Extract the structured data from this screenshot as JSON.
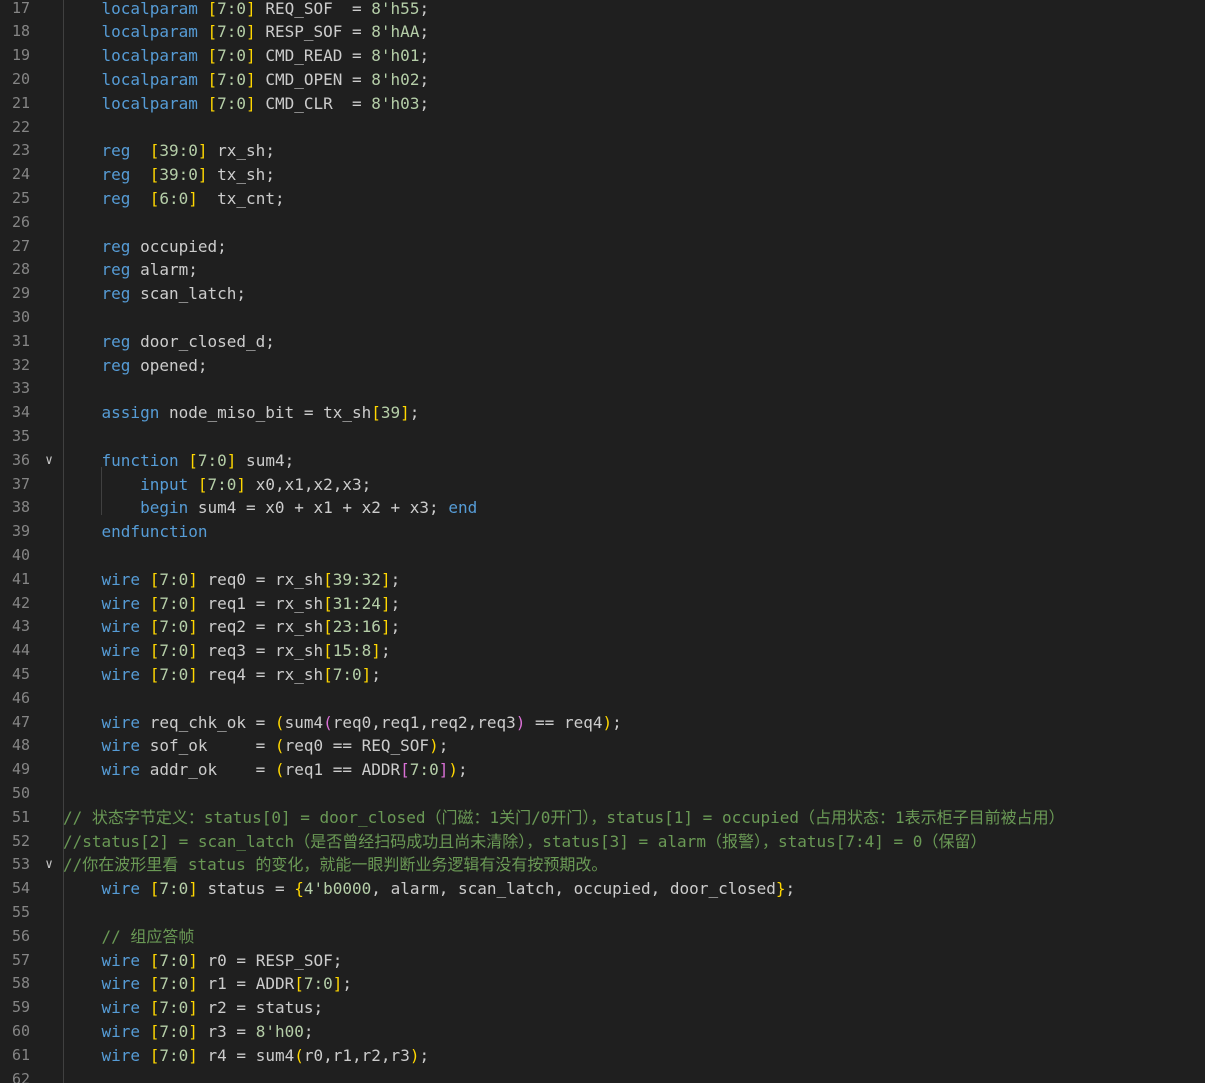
{
  "editor": {
    "language": "verilog",
    "first_line_number": 17,
    "folded_lines": [
      36,
      53
    ],
    "lines": [
      {
        "n": "17",
        "tokens": [
          [
            "    ",
            ""
          ],
          [
            "localparam",
            "kw"
          ],
          [
            " ",
            ""
          ],
          [
            "[",
            "b1"
          ],
          [
            "7:0",
            "num"
          ],
          [
            "]",
            "b1"
          ],
          [
            " REQ_SOF  = ",
            "id"
          ],
          [
            "8'h55",
            "num"
          ],
          [
            ";",
            "id"
          ]
        ]
      },
      {
        "n": "18",
        "tokens": [
          [
            "    ",
            ""
          ],
          [
            "localparam",
            "kw"
          ],
          [
            " ",
            ""
          ],
          [
            "[",
            "b1"
          ],
          [
            "7:0",
            "num"
          ],
          [
            "]",
            "b1"
          ],
          [
            " RESP_SOF = ",
            "id"
          ],
          [
            "8'hAA",
            "num"
          ],
          [
            ";",
            "id"
          ]
        ]
      },
      {
        "n": "19",
        "tokens": [
          [
            "    ",
            ""
          ],
          [
            "localparam",
            "kw"
          ],
          [
            " ",
            ""
          ],
          [
            "[",
            "b1"
          ],
          [
            "7:0",
            "num"
          ],
          [
            "]",
            "b1"
          ],
          [
            " CMD_READ = ",
            "id"
          ],
          [
            "8'h01",
            "num"
          ],
          [
            ";",
            "id"
          ]
        ]
      },
      {
        "n": "20",
        "tokens": [
          [
            "    ",
            ""
          ],
          [
            "localparam",
            "kw"
          ],
          [
            " ",
            ""
          ],
          [
            "[",
            "b1"
          ],
          [
            "7:0",
            "num"
          ],
          [
            "]",
            "b1"
          ],
          [
            " CMD_OPEN = ",
            "id"
          ],
          [
            "8'h02",
            "num"
          ],
          [
            ";",
            "id"
          ]
        ]
      },
      {
        "n": "21",
        "tokens": [
          [
            "    ",
            ""
          ],
          [
            "localparam",
            "kw"
          ],
          [
            " ",
            ""
          ],
          [
            "[",
            "b1"
          ],
          [
            "7:0",
            "num"
          ],
          [
            "]",
            "b1"
          ],
          [
            " CMD_CLR  = ",
            "id"
          ],
          [
            "8'h03",
            "num"
          ],
          [
            ";",
            "id"
          ]
        ]
      },
      {
        "n": "22",
        "tokens": []
      },
      {
        "n": "23",
        "tokens": [
          [
            "    ",
            ""
          ],
          [
            "reg",
            "kw"
          ],
          [
            "  ",
            ""
          ],
          [
            "[",
            "b1"
          ],
          [
            "39:0",
            "num"
          ],
          [
            "]",
            "b1"
          ],
          [
            " rx_sh;",
            "id"
          ]
        ]
      },
      {
        "n": "24",
        "tokens": [
          [
            "    ",
            ""
          ],
          [
            "reg",
            "kw"
          ],
          [
            "  ",
            ""
          ],
          [
            "[",
            "b1"
          ],
          [
            "39:0",
            "num"
          ],
          [
            "]",
            "b1"
          ],
          [
            " tx_sh;",
            "id"
          ]
        ]
      },
      {
        "n": "25",
        "tokens": [
          [
            "    ",
            ""
          ],
          [
            "reg",
            "kw"
          ],
          [
            "  ",
            ""
          ],
          [
            "[",
            "b1"
          ],
          [
            "6:0",
            "num"
          ],
          [
            "]",
            "b1"
          ],
          [
            "  tx_cnt;",
            "id"
          ]
        ]
      },
      {
        "n": "26",
        "tokens": []
      },
      {
        "n": "27",
        "tokens": [
          [
            "    ",
            ""
          ],
          [
            "reg",
            "kw"
          ],
          [
            " occupied;",
            "id"
          ]
        ]
      },
      {
        "n": "28",
        "tokens": [
          [
            "    ",
            ""
          ],
          [
            "reg",
            "kw"
          ],
          [
            " alarm;",
            "id"
          ]
        ]
      },
      {
        "n": "29",
        "tokens": [
          [
            "    ",
            ""
          ],
          [
            "reg",
            "kw"
          ],
          [
            " scan_latch;",
            "id"
          ]
        ]
      },
      {
        "n": "30",
        "tokens": []
      },
      {
        "n": "31",
        "tokens": [
          [
            "    ",
            ""
          ],
          [
            "reg",
            "kw"
          ],
          [
            " door_closed_d;",
            "id"
          ]
        ]
      },
      {
        "n": "32",
        "tokens": [
          [
            "    ",
            ""
          ],
          [
            "reg",
            "kw"
          ],
          [
            " opened;",
            "id"
          ]
        ]
      },
      {
        "n": "33",
        "tokens": []
      },
      {
        "n": "34",
        "tokens": [
          [
            "    ",
            ""
          ],
          [
            "assign",
            "kw"
          ],
          [
            " node_miso_bit = tx_sh",
            "id"
          ],
          [
            "[",
            "b1"
          ],
          [
            "39",
            "num"
          ],
          [
            "]",
            "b1"
          ],
          [
            ";",
            "id"
          ]
        ]
      },
      {
        "n": "35",
        "tokens": []
      },
      {
        "n": "36",
        "tokens": [
          [
            "    ",
            ""
          ],
          [
            "function",
            "kw"
          ],
          [
            " ",
            ""
          ],
          [
            "[",
            "b1"
          ],
          [
            "7:0",
            "num"
          ],
          [
            "]",
            "b1"
          ],
          [
            " sum4;",
            "id"
          ]
        ]
      },
      {
        "n": "37",
        "tokens": [
          [
            "        ",
            ""
          ],
          [
            "input",
            "kw"
          ],
          [
            " ",
            ""
          ],
          [
            "[",
            "b1"
          ],
          [
            "7:0",
            "num"
          ],
          [
            "]",
            "b1"
          ],
          [
            " x0,x1,x2,x3;",
            "id"
          ]
        ]
      },
      {
        "n": "38",
        "tokens": [
          [
            "        ",
            ""
          ],
          [
            "begin",
            "kw"
          ],
          [
            " sum4 = x0 + x1 + x2 + x3; ",
            "id"
          ],
          [
            "end",
            "kw"
          ]
        ]
      },
      {
        "n": "39",
        "tokens": [
          [
            "    ",
            ""
          ],
          [
            "endfunction",
            "kw"
          ]
        ]
      },
      {
        "n": "40",
        "tokens": []
      },
      {
        "n": "41",
        "tokens": [
          [
            "    ",
            ""
          ],
          [
            "wire",
            "kw"
          ],
          [
            " ",
            ""
          ],
          [
            "[",
            "b1"
          ],
          [
            "7:0",
            "num"
          ],
          [
            "]",
            "b1"
          ],
          [
            " req0 = rx_sh",
            "id"
          ],
          [
            "[",
            "b1"
          ],
          [
            "39:32",
            "num"
          ],
          [
            "]",
            "b1"
          ],
          [
            ";",
            "id"
          ]
        ]
      },
      {
        "n": "42",
        "tokens": [
          [
            "    ",
            ""
          ],
          [
            "wire",
            "kw"
          ],
          [
            " ",
            ""
          ],
          [
            "[",
            "b1"
          ],
          [
            "7:0",
            "num"
          ],
          [
            "]",
            "b1"
          ],
          [
            " req1 = rx_sh",
            "id"
          ],
          [
            "[",
            "b1"
          ],
          [
            "31:24",
            "num"
          ],
          [
            "]",
            "b1"
          ],
          [
            ";",
            "id"
          ]
        ]
      },
      {
        "n": "43",
        "tokens": [
          [
            "    ",
            ""
          ],
          [
            "wire",
            "kw"
          ],
          [
            " ",
            ""
          ],
          [
            "[",
            "b1"
          ],
          [
            "7:0",
            "num"
          ],
          [
            "]",
            "b1"
          ],
          [
            " req2 = rx_sh",
            "id"
          ],
          [
            "[",
            "b1"
          ],
          [
            "23:16",
            "num"
          ],
          [
            "]",
            "b1"
          ],
          [
            ";",
            "id"
          ]
        ]
      },
      {
        "n": "44",
        "tokens": [
          [
            "    ",
            ""
          ],
          [
            "wire",
            "kw"
          ],
          [
            " ",
            ""
          ],
          [
            "[",
            "b1"
          ],
          [
            "7:0",
            "num"
          ],
          [
            "]",
            "b1"
          ],
          [
            " req3 = rx_sh",
            "id"
          ],
          [
            "[",
            "b1"
          ],
          [
            "15:8",
            "num"
          ],
          [
            "]",
            "b1"
          ],
          [
            ";",
            "id"
          ]
        ]
      },
      {
        "n": "45",
        "tokens": [
          [
            "    ",
            ""
          ],
          [
            "wire",
            "kw"
          ],
          [
            " ",
            ""
          ],
          [
            "[",
            "b1"
          ],
          [
            "7:0",
            "num"
          ],
          [
            "]",
            "b1"
          ],
          [
            " req4 = rx_sh",
            "id"
          ],
          [
            "[",
            "b1"
          ],
          [
            "7:0",
            "num"
          ],
          [
            "]",
            "b1"
          ],
          [
            ";",
            "id"
          ]
        ]
      },
      {
        "n": "46",
        "tokens": []
      },
      {
        "n": "47",
        "tokens": [
          [
            "    ",
            ""
          ],
          [
            "wire",
            "kw"
          ],
          [
            " req_chk_ok = ",
            "id"
          ],
          [
            "(",
            "b1"
          ],
          [
            "sum4",
            "id"
          ],
          [
            "(",
            "b2"
          ],
          [
            "req0,req1,req2,req3",
            "id"
          ],
          [
            ")",
            "b2"
          ],
          [
            " == req4",
            "id"
          ],
          [
            ")",
            "b1"
          ],
          [
            ";",
            "id"
          ]
        ]
      },
      {
        "n": "48",
        "tokens": [
          [
            "    ",
            ""
          ],
          [
            "wire",
            "kw"
          ],
          [
            " sof_ok     = ",
            "id"
          ],
          [
            "(",
            "b1"
          ],
          [
            "req0 == REQ_SOF",
            "id"
          ],
          [
            ")",
            "b1"
          ],
          [
            ";",
            "id"
          ]
        ]
      },
      {
        "n": "49",
        "tokens": [
          [
            "    ",
            ""
          ],
          [
            "wire",
            "kw"
          ],
          [
            " addr_ok    = ",
            "id"
          ],
          [
            "(",
            "b1"
          ],
          [
            "req1 == ADDR",
            "id"
          ],
          [
            "[",
            "b2"
          ],
          [
            "7:0",
            "num"
          ],
          [
            "]",
            "b2"
          ],
          [
            ")",
            "b1"
          ],
          [
            ";",
            "id"
          ]
        ]
      },
      {
        "n": "50",
        "tokens": []
      },
      {
        "n": "51",
        "tokens": [
          [
            "// 状态字节定义：status[0] = door_closed（门磁：1关门/0开门），status[1] = occupied（占用状态：1表示柜子目前被占用）",
            "cm"
          ]
        ]
      },
      {
        "n": "52",
        "tokens": [
          [
            "//status[2] = scan_latch（是否曾经扫码成功且尚未清除），status[3] = alarm（报警），status[7:4] = 0（保留）",
            "cm"
          ]
        ]
      },
      {
        "n": "53",
        "tokens": [
          [
            "//你在波形里看 status 的变化，就能一眼判断业务逻辑有没有按预期改。",
            "cm"
          ]
        ]
      },
      {
        "n": "54",
        "tokens": [
          [
            "    ",
            ""
          ],
          [
            "wire",
            "kw"
          ],
          [
            " ",
            ""
          ],
          [
            "[",
            "b1"
          ],
          [
            "7:0",
            "num"
          ],
          [
            "]",
            "b1"
          ],
          [
            " status = ",
            "id"
          ],
          [
            "{",
            "b1"
          ],
          [
            "4'b0000",
            "num"
          ],
          [
            ", alarm, scan_latch, occupied, door_closed",
            "id"
          ],
          [
            "}",
            "b1"
          ],
          [
            ";",
            "id"
          ]
        ]
      },
      {
        "n": "55",
        "tokens": []
      },
      {
        "n": "56",
        "tokens": [
          [
            "    ",
            ""
          ],
          [
            "// 组应答帧",
            "cm"
          ]
        ]
      },
      {
        "n": "57",
        "tokens": [
          [
            "    ",
            ""
          ],
          [
            "wire",
            "kw"
          ],
          [
            " ",
            ""
          ],
          [
            "[",
            "b1"
          ],
          [
            "7:0",
            "num"
          ],
          [
            "]",
            "b1"
          ],
          [
            " r0 = RESP_SOF;",
            "id"
          ]
        ]
      },
      {
        "n": "58",
        "tokens": [
          [
            "    ",
            ""
          ],
          [
            "wire",
            "kw"
          ],
          [
            " ",
            ""
          ],
          [
            "[",
            "b1"
          ],
          [
            "7:0",
            "num"
          ],
          [
            "]",
            "b1"
          ],
          [
            " r1 = ADDR",
            "id"
          ],
          [
            "[",
            "b1"
          ],
          [
            "7:0",
            "num"
          ],
          [
            "]",
            "b1"
          ],
          [
            ";",
            "id"
          ]
        ]
      },
      {
        "n": "59",
        "tokens": [
          [
            "    ",
            ""
          ],
          [
            "wire",
            "kw"
          ],
          [
            " ",
            ""
          ],
          [
            "[",
            "b1"
          ],
          [
            "7:0",
            "num"
          ],
          [
            "]",
            "b1"
          ],
          [
            " r2 = status;",
            "id"
          ]
        ]
      },
      {
        "n": "60",
        "tokens": [
          [
            "    ",
            ""
          ],
          [
            "wire",
            "kw"
          ],
          [
            " ",
            ""
          ],
          [
            "[",
            "b1"
          ],
          [
            "7:0",
            "num"
          ],
          [
            "]",
            "b1"
          ],
          [
            " r3 = ",
            "id"
          ],
          [
            "8'h00",
            "num"
          ],
          [
            ";",
            "id"
          ]
        ]
      },
      {
        "n": "61",
        "tokens": [
          [
            "    ",
            ""
          ],
          [
            "wire",
            "kw"
          ],
          [
            " ",
            ""
          ],
          [
            "[",
            "b1"
          ],
          [
            "7:0",
            "num"
          ],
          [
            "]",
            "b1"
          ],
          [
            " r4 = ",
            "id"
          ],
          [
            "sum4",
            "id"
          ],
          [
            "(",
            "b1"
          ],
          [
            "r0,r1,r2,r3",
            "id"
          ],
          [
            ")",
            "b1"
          ],
          [
            ";",
            "id"
          ]
        ]
      },
      {
        "n": "62",
        "tokens": []
      }
    ]
  }
}
